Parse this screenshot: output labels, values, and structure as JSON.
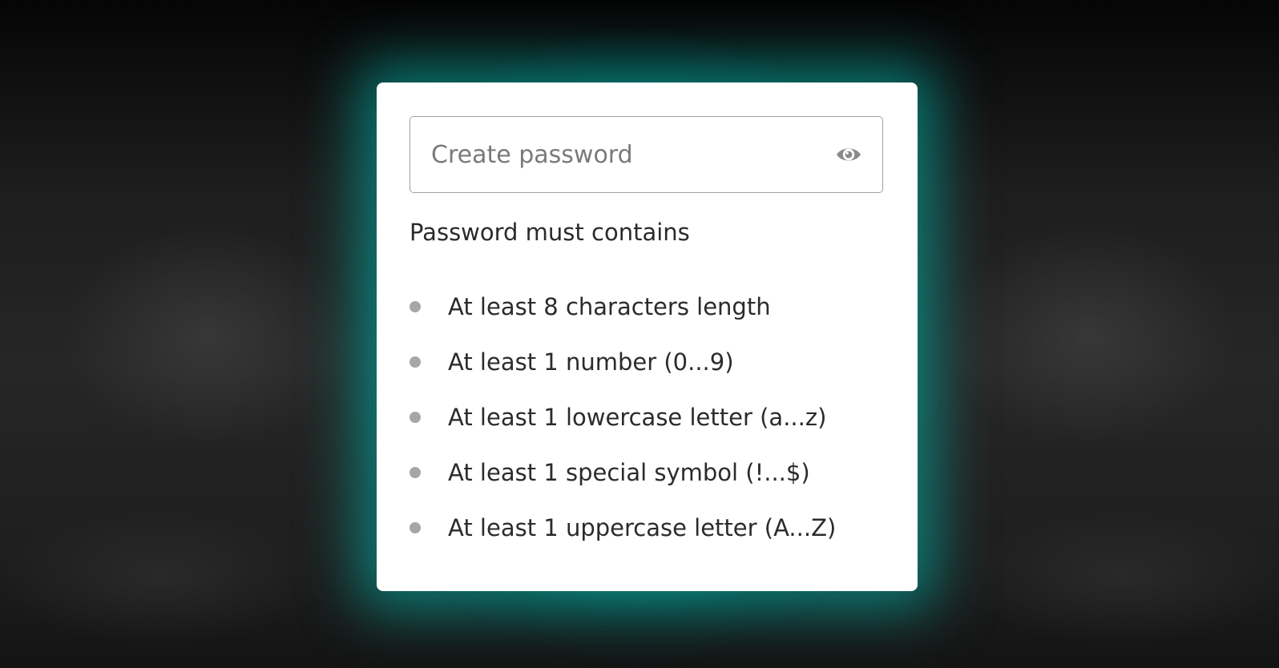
{
  "password_field": {
    "value": "",
    "placeholder": "Create password",
    "toggle_icon": "eye-icon"
  },
  "requirements": {
    "title": "Password must contains",
    "items": [
      {
        "label": "At least 8 characters length"
      },
      {
        "label": "At least 1 number (0...9)"
      },
      {
        "label": "At least 1 lowercase letter (a...z)"
      },
      {
        "label": "At least 1 special symbol (!...$)"
      },
      {
        "label": "At least 1 uppercase letter (A...Z)"
      }
    ]
  },
  "colors": {
    "glow": "#00bfb6",
    "card": "#ffffff",
    "bullet": "#a6a6a6",
    "text": "#2b2b2b",
    "background": "#1e1e1e"
  }
}
